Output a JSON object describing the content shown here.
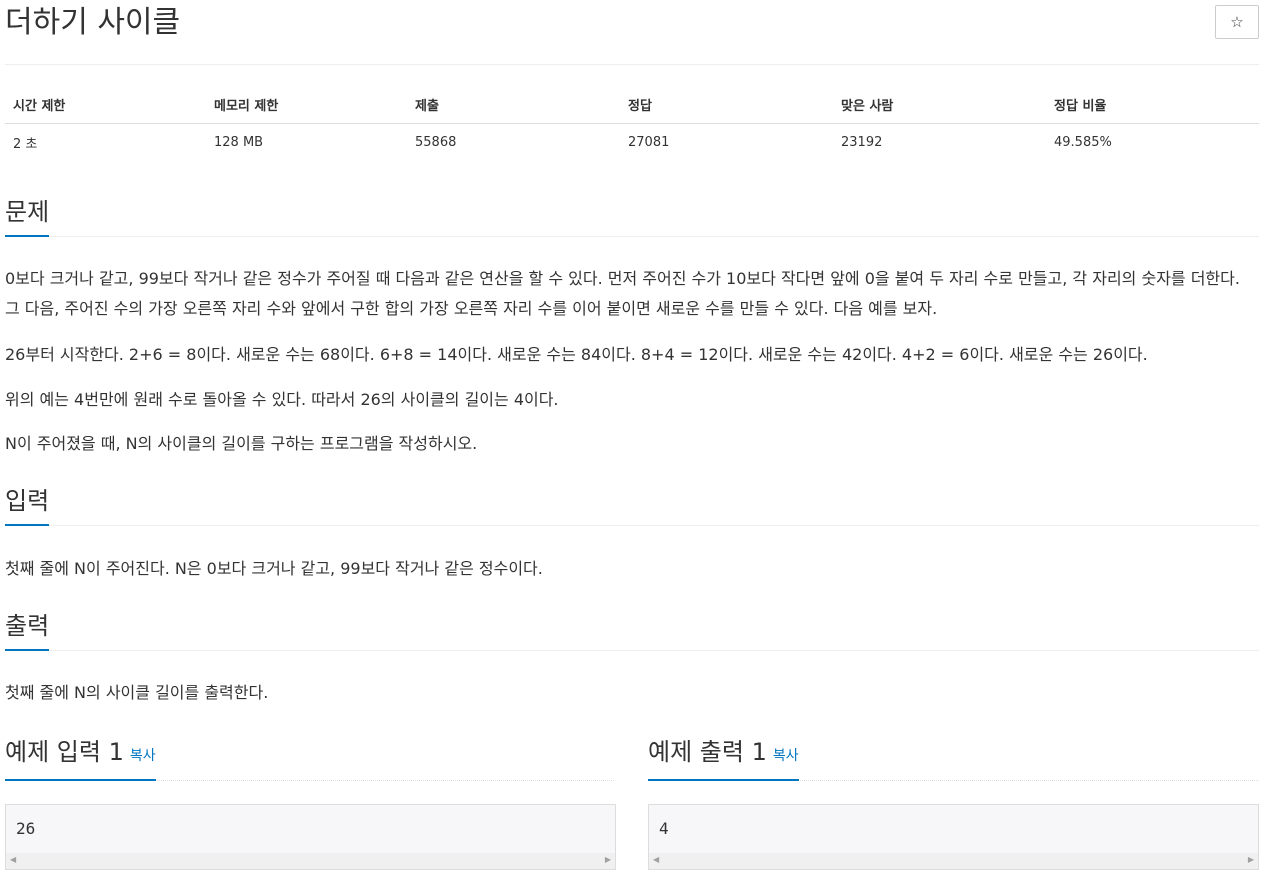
{
  "title": "더하기 사이클",
  "star_icon": "☆",
  "stats": {
    "headers": [
      "시간 제한",
      "메모리 제한",
      "제출",
      "정답",
      "맞은 사람",
      "정답 비율"
    ],
    "values": [
      "2 초",
      "128 MB",
      "55868",
      "27081",
      "23192",
      "49.585%"
    ]
  },
  "problem": {
    "heading": "문제",
    "paragraphs": [
      "0보다 크거나 같고, 99보다 작거나 같은 정수가 주어질 때 다음과 같은 연산을 할 수 있다. 먼저 주어진 수가 10보다 작다면 앞에 0을 붙여 두 자리 수로 만들고, 각 자리의 숫자를 더한다. 그 다음, 주어진 수의 가장 오른쪽 자리 수와 앞에서 구한 합의 가장 오른쪽 자리 수를 이어 붙이면 새로운 수를 만들 수 있다. 다음 예를 보자.",
      "26부터 시작한다. 2+6 = 8이다. 새로운 수는 68이다. 6+8 = 14이다. 새로운 수는 84이다. 8+4 = 12이다. 새로운 수는 42이다. 4+2 = 6이다. 새로운 수는 26이다.",
      "위의 예는 4번만에 원래 수로 돌아올 수 있다. 따라서 26의 사이클의 길이는 4이다.",
      "N이 주어졌을 때, N의 사이클의 길이를 구하는 프로그램을 작성하시오."
    ]
  },
  "input": {
    "heading": "입력",
    "text": "첫째 줄에 N이 주어진다. N은 0보다 크거나 같고, 99보다 작거나 같은 정수이다."
  },
  "output": {
    "heading": "출력",
    "text": "첫째 줄에 N의 사이클 길이를 출력한다."
  },
  "samples": {
    "input": {
      "heading": "예제 입력",
      "number": "1",
      "copy_label": "복사",
      "content": "26"
    },
    "output": {
      "heading": "예제 출력",
      "number": "1",
      "copy_label": "복사",
      "content": "4"
    }
  },
  "colors": {
    "accent": "#0076c0",
    "text": "#333333",
    "code_bg": "#f7f7f9"
  }
}
